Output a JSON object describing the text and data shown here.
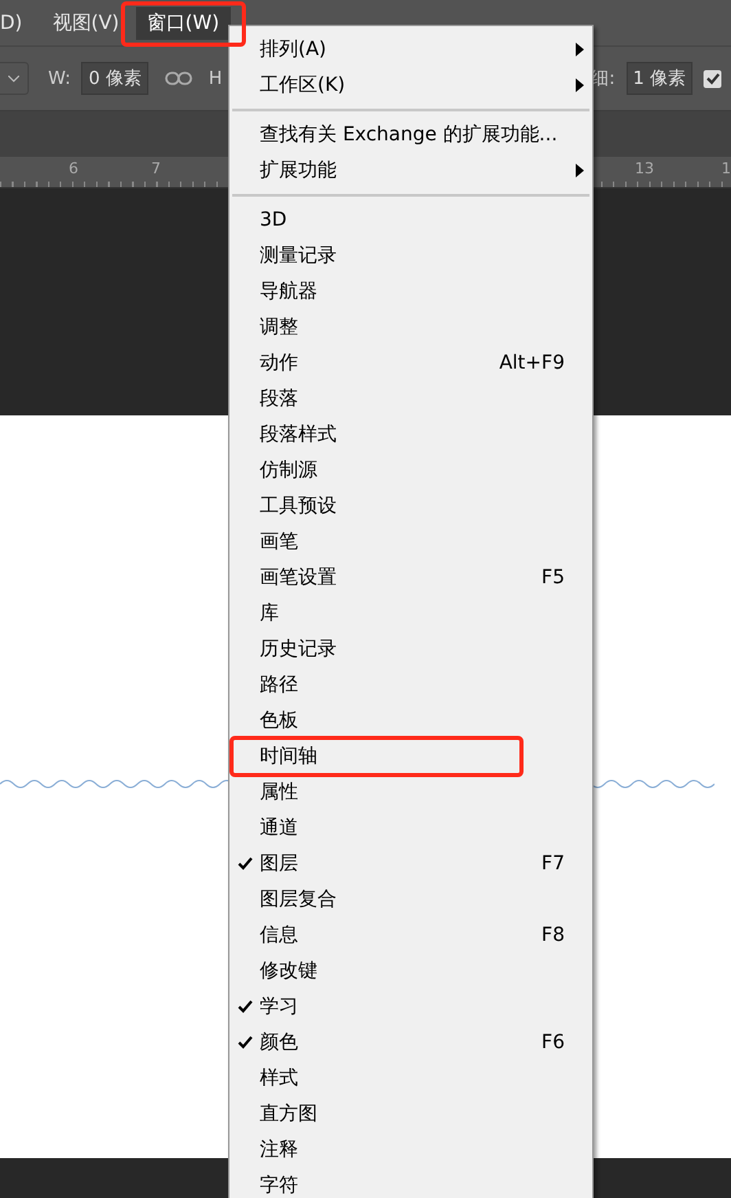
{
  "menu_bar": [
    {
      "label": "D)",
      "selected": false
    },
    {
      "label": "视图(V)",
      "selected": false
    },
    {
      "label": "窗口(W)",
      "selected": true
    }
  ],
  "options_bar": {
    "width_label": "W:",
    "width_value": "0 像素",
    "height_label": "H",
    "stroke_label": "细:",
    "stroke_value": "1 像素",
    "align_checked": true
  },
  "ruler": [
    "6",
    "7",
    "13",
    "1"
  ],
  "window_menu": [
    {
      "kind": "item",
      "label": "排列(A)",
      "submenu": true,
      "checked": false
    },
    {
      "kind": "item",
      "label": "工作区(K)",
      "submenu": true,
      "checked": false
    },
    {
      "kind": "separator"
    },
    {
      "kind": "item",
      "label": "查找有关 Exchange 的扩展功能...",
      "submenu": false,
      "checked": false
    },
    {
      "kind": "item",
      "label": "扩展功能",
      "submenu": true,
      "checked": false
    },
    {
      "kind": "separator"
    },
    {
      "kind": "item",
      "label": "3D",
      "submenu": false,
      "checked": false
    },
    {
      "kind": "item",
      "label": "测量记录",
      "submenu": false,
      "checked": false
    },
    {
      "kind": "item",
      "label": "导航器",
      "submenu": false,
      "checked": false
    },
    {
      "kind": "item",
      "label": "调整",
      "submenu": false,
      "checked": false
    },
    {
      "kind": "item",
      "label": "动作",
      "shortcut": "Alt+F9",
      "submenu": false,
      "checked": false
    },
    {
      "kind": "item",
      "label": "段落",
      "submenu": false,
      "checked": false
    },
    {
      "kind": "item",
      "label": "段落样式",
      "submenu": false,
      "checked": false
    },
    {
      "kind": "item",
      "label": "仿制源",
      "submenu": false,
      "checked": false
    },
    {
      "kind": "item",
      "label": "工具预设",
      "submenu": false,
      "checked": false
    },
    {
      "kind": "item",
      "label": "画笔",
      "submenu": false,
      "checked": false
    },
    {
      "kind": "item",
      "label": "画笔设置",
      "shortcut": "F5",
      "submenu": false,
      "checked": false
    },
    {
      "kind": "item",
      "label": "库",
      "submenu": false,
      "checked": false
    },
    {
      "kind": "item",
      "label": "历史记录",
      "submenu": false,
      "checked": false
    },
    {
      "kind": "item",
      "label": "路径",
      "submenu": false,
      "checked": false
    },
    {
      "kind": "item",
      "label": "色板",
      "submenu": false,
      "checked": false
    },
    {
      "kind": "item",
      "label": "时间轴",
      "submenu": false,
      "checked": false,
      "highlighted": true
    },
    {
      "kind": "item",
      "label": "属性",
      "submenu": false,
      "checked": false
    },
    {
      "kind": "item",
      "label": "通道",
      "submenu": false,
      "checked": false
    },
    {
      "kind": "item",
      "label": "图层",
      "shortcut": "F7",
      "submenu": false,
      "checked": true
    },
    {
      "kind": "item",
      "label": "图层复合",
      "submenu": false,
      "checked": false
    },
    {
      "kind": "item",
      "label": "信息",
      "shortcut": "F8",
      "submenu": false,
      "checked": false
    },
    {
      "kind": "item",
      "label": "修改键",
      "submenu": false,
      "checked": false
    },
    {
      "kind": "item",
      "label": "学习",
      "submenu": false,
      "checked": true
    },
    {
      "kind": "item",
      "label": "颜色",
      "shortcut": "F6",
      "submenu": false,
      "checked": true
    },
    {
      "kind": "item",
      "label": "样式",
      "submenu": false,
      "checked": false
    },
    {
      "kind": "item",
      "label": "直方图",
      "submenu": false,
      "checked": false
    },
    {
      "kind": "item",
      "label": "注释",
      "submenu": false,
      "checked": false
    },
    {
      "kind": "item",
      "label": "字符",
      "submenu": false,
      "checked": false
    }
  ]
}
